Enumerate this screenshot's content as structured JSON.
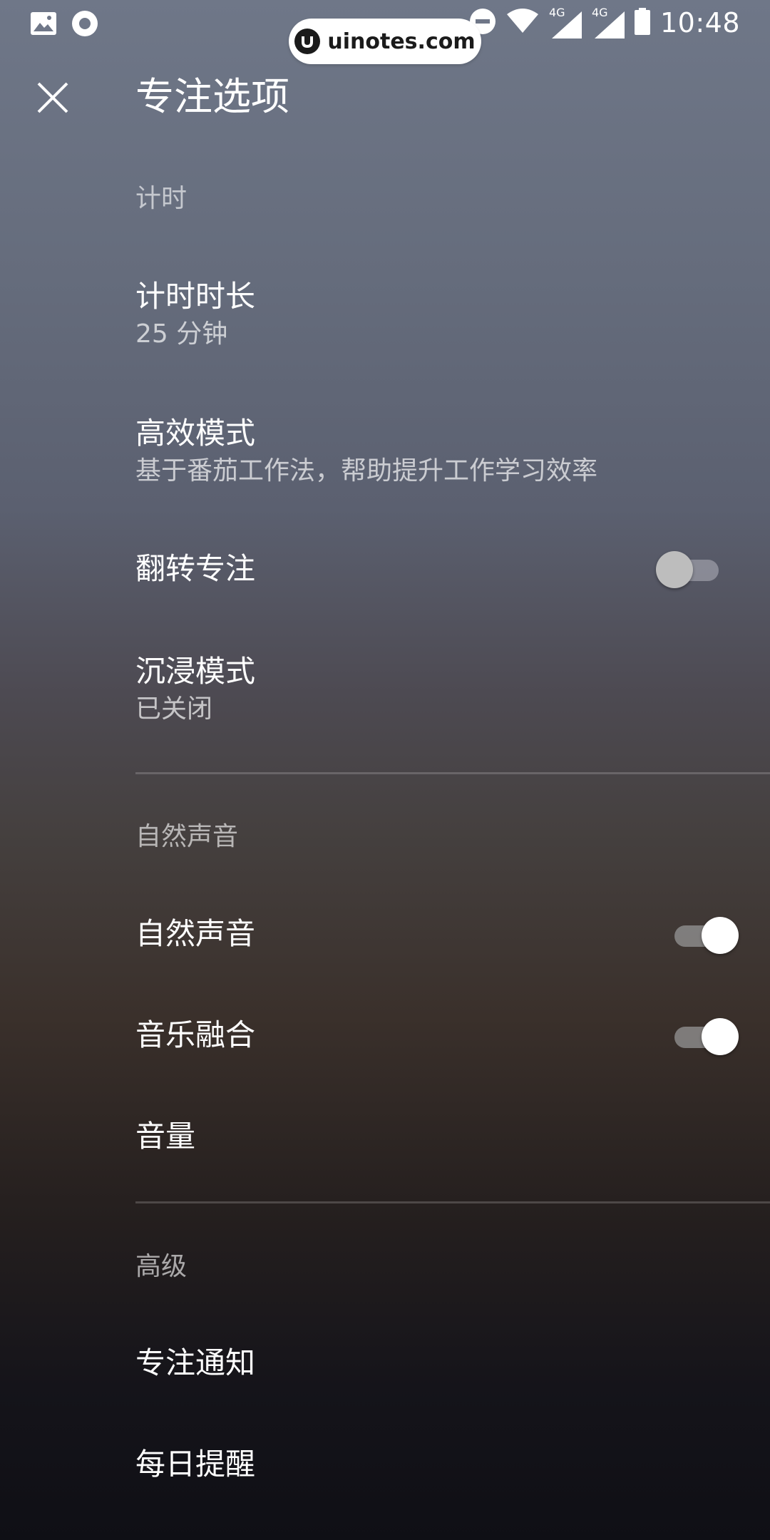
{
  "status_bar": {
    "time": "10:48",
    "network_1": "4G",
    "network_2": "4G",
    "left_icons": [
      "image-icon",
      "circle-notification-icon"
    ],
    "right_icons": [
      "do-not-disturb-icon",
      "wifi-icon",
      "signal-icon",
      "signal-icon",
      "battery-icon"
    ]
  },
  "watermark": {
    "text": "uinotes.com"
  },
  "header": {
    "title": "专注选项",
    "close_icon": "close-icon"
  },
  "sections": {
    "timing": {
      "header": "计时",
      "duration": {
        "title": "计时时长",
        "value": "25 分钟"
      },
      "efficient": {
        "title": "高效模式",
        "subtitle": "基于番茄工作法，帮助提升工作学习效率"
      },
      "flip": {
        "title": "翻转专注",
        "enabled": false
      },
      "immersive": {
        "title": "沉浸模式",
        "value": "已关闭"
      }
    },
    "sound": {
      "header": "自然声音",
      "nature": {
        "title": "自然声音",
        "enabled": true
      },
      "music_mix": {
        "title": "音乐融合",
        "enabled": true
      },
      "volume": {
        "title": "音量"
      }
    },
    "advanced": {
      "header": "高级",
      "notification": {
        "title": "专注通知"
      },
      "daily_reminder": {
        "title": "每日提醒"
      }
    }
  },
  "colors": {
    "switch_on_thumb": "#ffffff",
    "switch_off_thumb": "#bdbdbd",
    "text_primary": "#ffffff"
  }
}
